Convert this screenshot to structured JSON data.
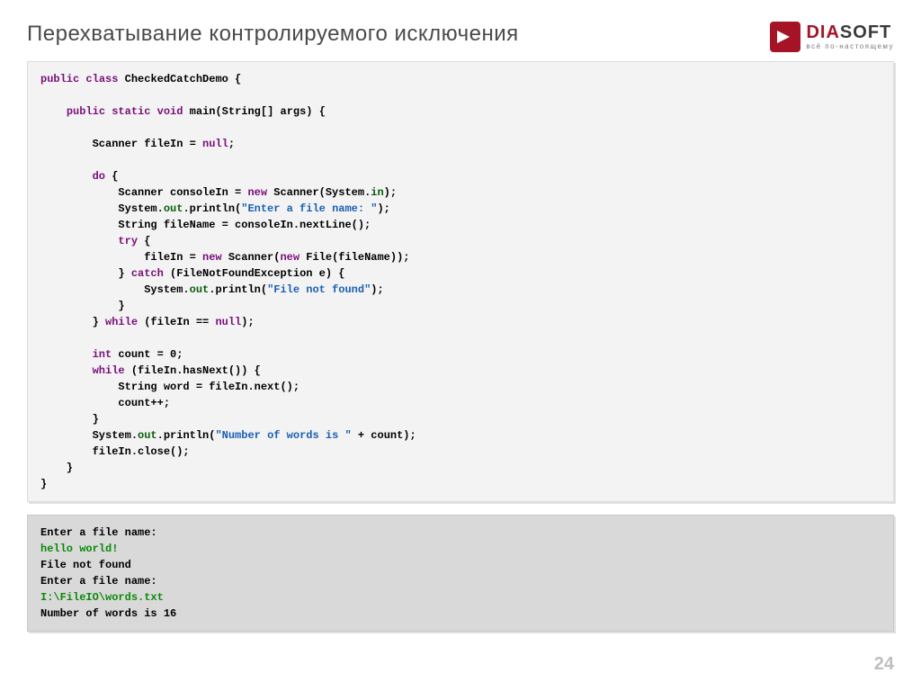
{
  "header": {
    "title": "Перехватывание контролируемого исключения",
    "logo": {
      "brand_prefix": "DIA",
      "brand_suffix": "SOFT",
      "tagline": "всё по-настоящему"
    }
  },
  "code": {
    "l01a": "public",
    "l01b": "class",
    "l01c": " CheckedCatchDemo {",
    "l02a": "public",
    "l02b": "static",
    "l02c": "void",
    "l02d": " main(String[] args) {",
    "l03a": "        Scanner fileIn = ",
    "l03b": "null",
    "l03c": ";",
    "l04a": "do",
    "l04b": " {",
    "l05a": "            Scanner consoleIn = ",
    "l05b": "new",
    "l05c": " Scanner(System.",
    "l05d": "in",
    "l05e": ");",
    "l06a": "            System.",
    "l06b": "out",
    "l06c": ".println(",
    "l06d": "\"Enter a file name: \"",
    "l06e": ");",
    "l07a": "            String fileName = consoleIn.nextLine();",
    "l08a": "try",
    "l08b": " {",
    "l09a": "                fileIn = ",
    "l09b": "new",
    "l09c": " Scanner(",
    "l09d": "new",
    "l09e": " File(fileName));",
    "l10a": "            } ",
    "l10b": "catch",
    "l10c": " (FileNotFoundException e) {",
    "l11a": "                System.",
    "l11b": "out",
    "l11c": ".println(",
    "l11d": "\"File not found\"",
    "l11e": ");",
    "l12a": "            }",
    "l13a": "        } ",
    "l13b": "while",
    "l13c": " (fileIn == ",
    "l13d": "null",
    "l13e": ");",
    "l14a": "int",
    "l14b": " count = 0;",
    "l15a": "while",
    "l15b": " (fileIn.hasNext()) {",
    "l16a": "            String word = fileIn.next();",
    "l17a": "            count++;",
    "l18a": "        }",
    "l19a": "        System.",
    "l19b": "out",
    "l19c": ".println(",
    "l19d": "\"Number of words is \"",
    "l19e": " + count);",
    "l20a": "        fileIn.close();",
    "l21a": "    }",
    "l22a": "}"
  },
  "output": {
    "o1": "Enter a file name:",
    "o2": "hello world!",
    "o3": "File not found",
    "o4": "Enter a file name:",
    "o5": "I:\\FileIO\\words.txt",
    "o6": "Number of words is 16"
  },
  "page_number": "24"
}
